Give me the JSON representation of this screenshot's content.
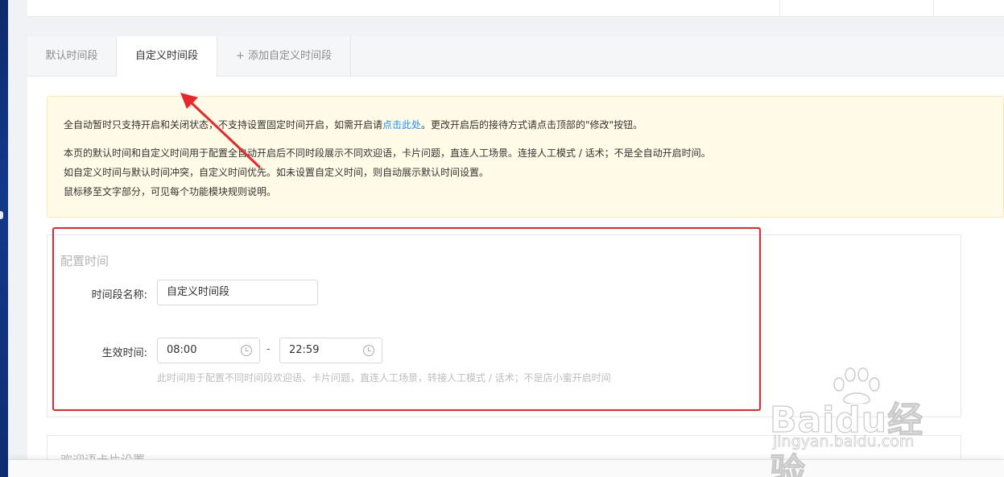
{
  "tabs": {
    "default_label": "默认时间段",
    "custom_label": "自定义时间段",
    "add_label": "+ 添加自定义时间段"
  },
  "notice": {
    "line1_before": "全自动暂时只支持开启和关闭状态，不支持设置固定时间开启，如需开启请",
    "line1_link": "点击此处",
    "line1_after": "。更改开启后的接待方式请点击顶部的\"修改\"按钮。",
    "line2": "本页的默认时间和自定义时间用于配置全自动开启后不同时段展示不同欢迎语，卡片问题，直连人工场景。连接人工模式 / 话术；不是全自动开启时间。",
    "line3": "如自定义时间与默认时间冲突，自定义时间优先。如未设置自定义时间，则自动展示默认时间设置。",
    "line4": "鼠标移至文字部分，可见每个功能模块规则说明。"
  },
  "config": {
    "section_title": "配置时间",
    "name_label": "时间段名称:",
    "name_value": "自定义时间段",
    "time_label": "生效时间:",
    "start_time": "08:00",
    "end_time": "22:59",
    "separator": "-",
    "hint": "此时间用于配置不同时间段欢迎语、卡片问题，直连人工场景，转接人工模式 / 话术；不是店小蜜开启时间"
  },
  "welcome": {
    "section_title": "欢迎语卡片设置"
  },
  "watermark": {
    "brand": "Baidu经验",
    "url": "jingyan.baidu.com"
  },
  "colors": {
    "accent": "#1890ff",
    "notice_bg": "#fffbe6",
    "highlight": "#e8262b",
    "arrow": "#e8262b"
  },
  "icons": {
    "clock": "clock-icon"
  }
}
